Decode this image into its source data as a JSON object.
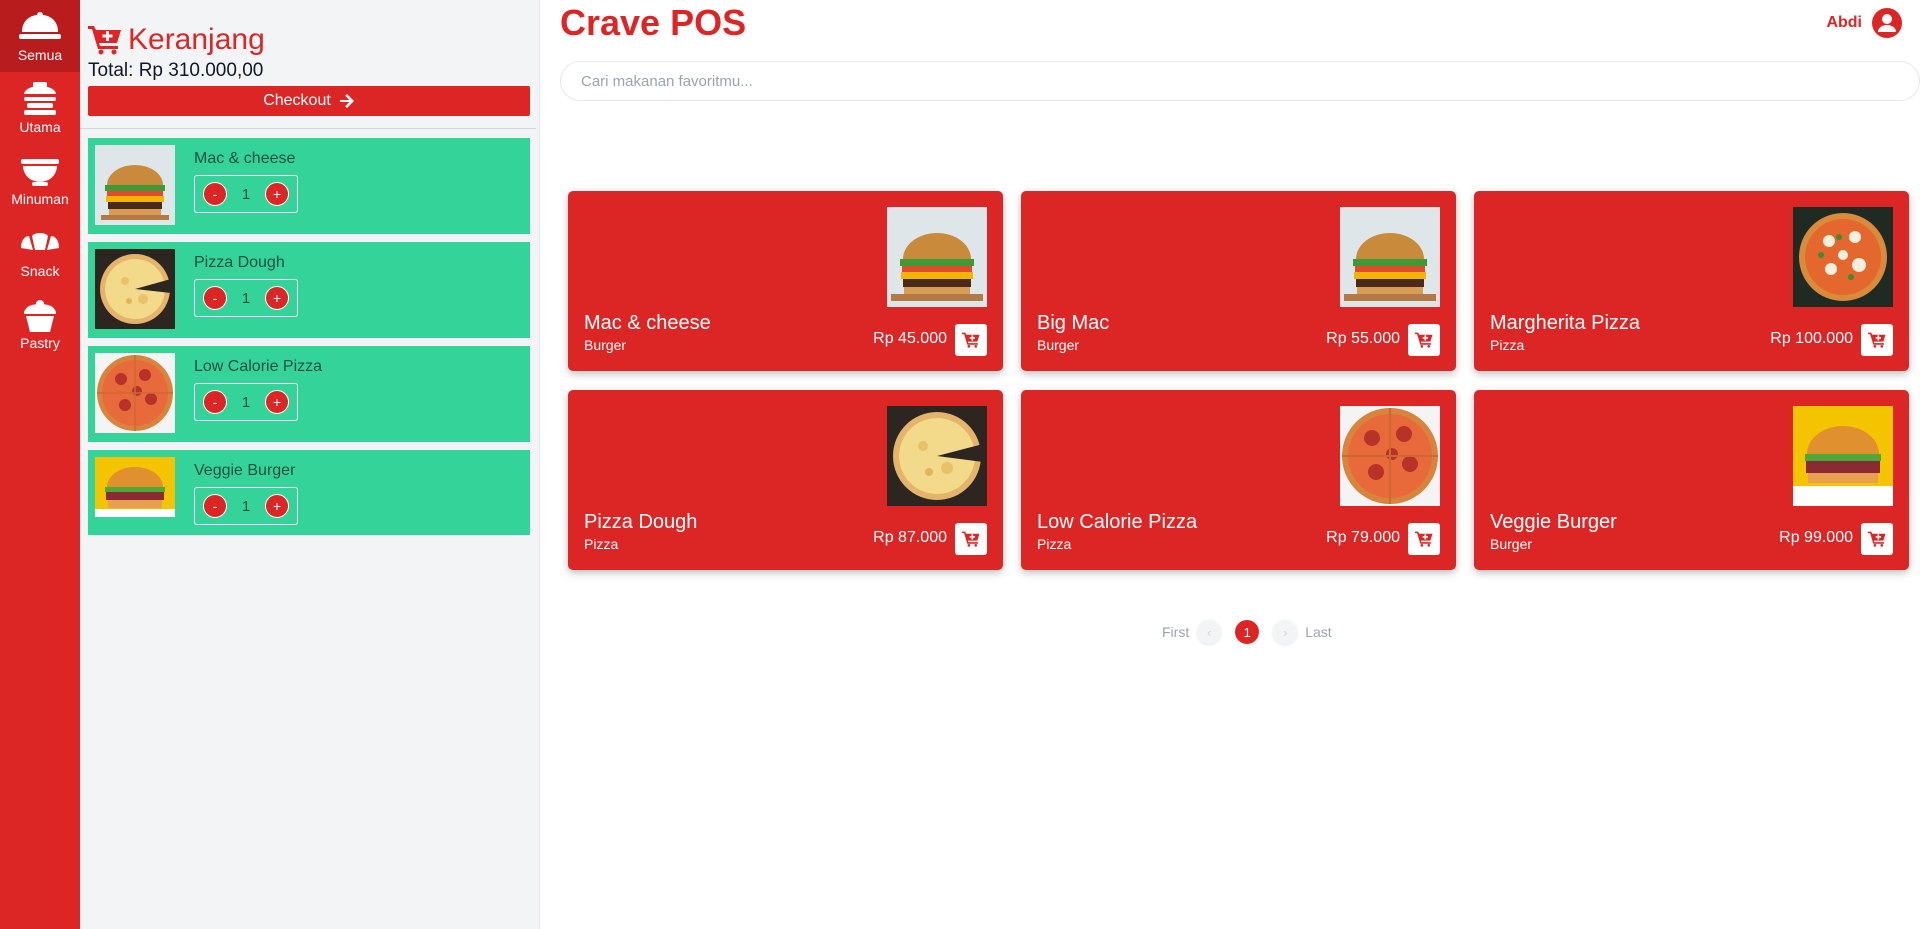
{
  "nav": {
    "items": [
      {
        "label": "Semua",
        "icon": "cloche-icon"
      },
      {
        "label": "Utama",
        "icon": "burger-icon"
      },
      {
        "label": "Minuman",
        "icon": "bowl-icon"
      },
      {
        "label": "Snack",
        "icon": "croissant-icon"
      },
      {
        "label": "Pastry",
        "icon": "cupcake-icon"
      }
    ],
    "active": "Semua"
  },
  "cart": {
    "title": "Keranjang",
    "total": "Total: Rp 310.000,00",
    "checkout_label": "Checkout",
    "items": [
      {
        "name": "Mac & cheese",
        "qty": "1",
        "image": "burger-image"
      },
      {
        "name": "Pizza Dough",
        "qty": "1",
        "image": "cheese-pizza-image"
      },
      {
        "name": "Low Calorie Pizza",
        "qty": "1",
        "image": "pepperoni-pizza-image"
      },
      {
        "name": "Veggie Burger",
        "qty": "1",
        "image": "veggie-burger-image"
      }
    ],
    "minus_label": "-",
    "plus_label": "+"
  },
  "header": {
    "brand": "Crave POS",
    "user_name": "Abdi"
  },
  "search": {
    "placeholder": "Cari makanan favoritmu...",
    "value": ""
  },
  "products": [
    {
      "name": "Mac & cheese",
      "category": "Burger",
      "price": "Rp 45.000",
      "image": "burger-image"
    },
    {
      "name": "Big Mac",
      "category": "Burger",
      "price": "Rp 55.000",
      "image": "burger-image"
    },
    {
      "name": "Margherita Pizza",
      "category": "Pizza",
      "price": "Rp 100.000",
      "image": "margherita-pizza-image"
    },
    {
      "name": "Pizza Dough",
      "category": "Pizza",
      "price": "Rp 87.000",
      "image": "cheese-pizza-image"
    },
    {
      "name": "Low Calorie Pizza",
      "category": "Pizza",
      "price": "Rp 79.000",
      "image": "pepperoni-pizza-image"
    },
    {
      "name": "Veggie Burger",
      "category": "Burger",
      "price": "Rp 99.000",
      "image": "veggie-burger-image"
    }
  ],
  "pagination": {
    "first": "First",
    "last": "Last",
    "current": "1",
    "prev": "‹",
    "next": "›"
  },
  "colors": {
    "primary": "#dc2626",
    "cart_item": "#34d399",
    "panel": "#f3f4f6"
  }
}
